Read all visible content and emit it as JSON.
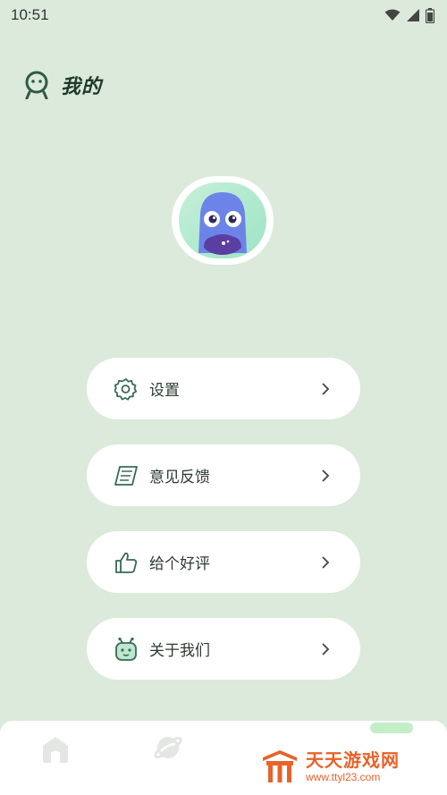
{
  "status_bar": {
    "time": "10:51",
    "icons": [
      "wifi-icon",
      "signal-icon",
      "battery-icon"
    ]
  },
  "header": {
    "title": "我的",
    "icon": "smiley-person-icon"
  },
  "profile": {
    "avatar": "blue-monster-avatar"
  },
  "menu": {
    "items": [
      {
        "label": "设置",
        "icon": "gear-icon"
      },
      {
        "label": "意见反馈",
        "icon": "notebook-icon"
      },
      {
        "label": "给个好评",
        "icon": "thumbs-up-icon"
      },
      {
        "label": "关于我们",
        "icon": "robot-icon"
      }
    ]
  },
  "bottom_nav": {
    "items": [
      "home-icon",
      "planet-icon",
      "profile-tab"
    ]
  },
  "watermark": {
    "title": "天天游戏网",
    "url": "www.ttyl23.com"
  },
  "colors": {
    "background": "#dbeadb",
    "accent": "#2f5a46",
    "watermark": "#e8622a"
  }
}
